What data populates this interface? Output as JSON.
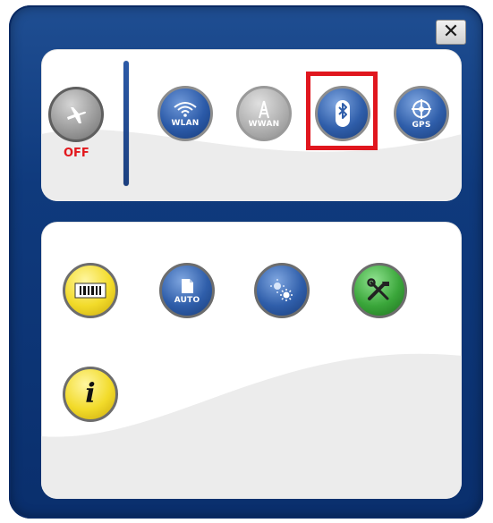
{
  "window": {
    "close_icon": "close-icon",
    "close_glyph": "✕"
  },
  "connectivity": {
    "airplane": {
      "icon": "airplane-icon",
      "state_label": "OFF"
    },
    "wlan": {
      "icon": "wifi-icon",
      "label": "WLAN"
    },
    "wwan": {
      "icon": "antenna-icon",
      "label": "WWAN"
    },
    "bluetooth": {
      "icon": "bluetooth-icon",
      "highlighted": true
    },
    "gps": {
      "icon": "target-icon",
      "label": "GPS"
    }
  },
  "tools": {
    "barcode": {
      "icon": "barcode-icon"
    },
    "auto": {
      "icon": "auto-document-icon",
      "label": "AUTO"
    },
    "brightness": {
      "icon": "brightness-icon"
    },
    "settings": {
      "icon": "tools-icon"
    },
    "info": {
      "icon": "info-icon",
      "label": "i"
    }
  },
  "colors": {
    "frame": "#123f84",
    "highlight": "#e0161e",
    "off_text": "#e2171c"
  }
}
